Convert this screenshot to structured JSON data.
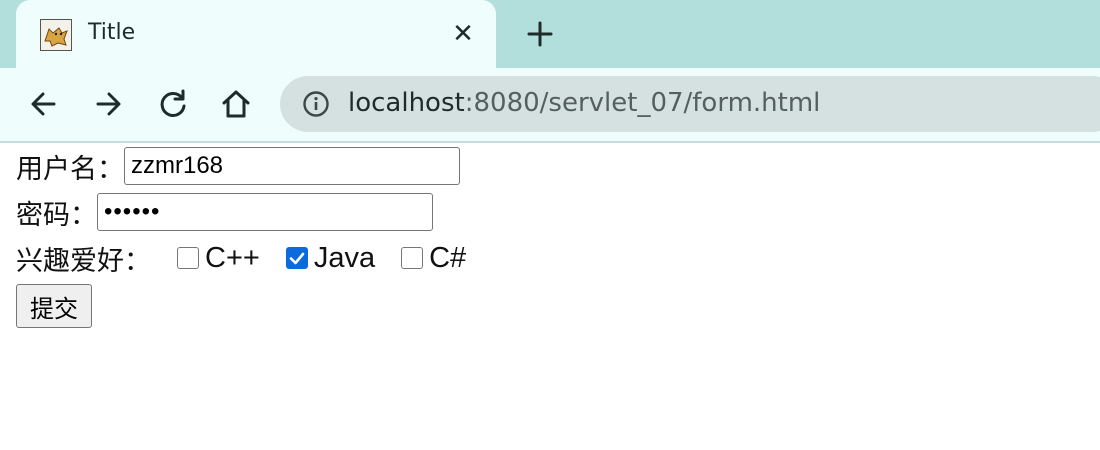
{
  "browser": {
    "tab": {
      "title": "Title",
      "favicon": "tomcat-icon",
      "close_icon": "close-icon"
    },
    "new_tab_icon": "plus-icon",
    "toolbar": {
      "back_icon": "arrow-left-icon",
      "forward_icon": "arrow-right-icon",
      "reload_icon": "reload-icon",
      "home_icon": "home-icon"
    },
    "omnibox": {
      "info_icon": "info-icon",
      "url_host": "localhost",
      "url_rest": ":8080/servlet_07/form.html"
    }
  },
  "form": {
    "username_label": "用户名：",
    "username_value": "zzmr168",
    "password_label": "密码：",
    "password_value": "••••••",
    "hobbies_label": "兴趣爱好：",
    "hobbies": [
      {
        "label": "C++",
        "checked": false
      },
      {
        "label": "Java",
        "checked": true
      },
      {
        "label": "C#",
        "checked": false
      }
    ],
    "submit_label": "提交"
  },
  "colors": {
    "tabstrip": "#b2dfdc",
    "toolbar": "#effdfd",
    "omnibox": "#d4e1e0",
    "checkbox_checked": "#0b6bde"
  }
}
